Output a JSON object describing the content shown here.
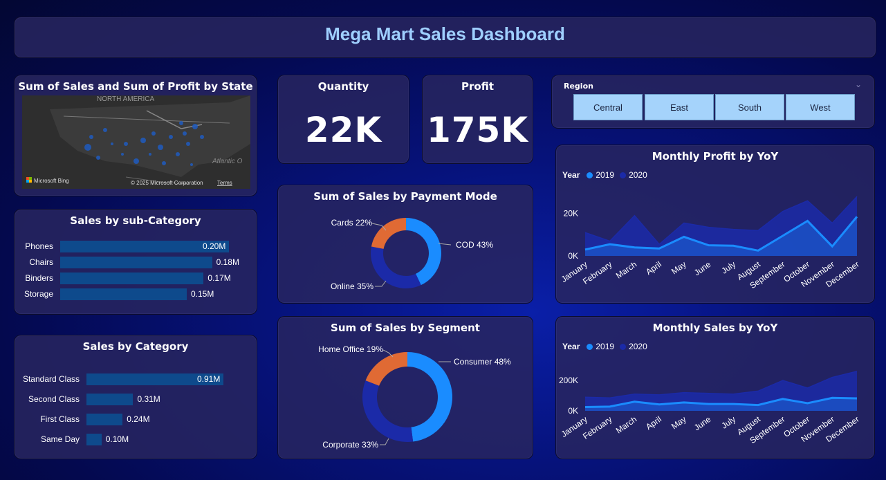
{
  "header": {
    "title": "Mega Mart Sales Dashboard"
  },
  "map_card": {
    "title": "Sum of Sales and Sum of Profit by State",
    "region_label": "NORTH AMERICA",
    "ocean_label": "Atlantic O",
    "bing": "Microsoft Bing",
    "copyright": "© 2025 Microsoft Corporation",
    "terms": "Terms"
  },
  "kpis": {
    "quantity": {
      "title": "Quantity",
      "value": "22K"
    },
    "profit": {
      "title": "Profit",
      "value": "175K"
    }
  },
  "region_slicer": {
    "title": "Region",
    "options": [
      "Central",
      "East",
      "South",
      "West"
    ]
  },
  "subcategory": {
    "title": "Sales by sub-Category",
    "rows": [
      {
        "label": "Phones",
        "value": 0.2,
        "value_label": "0.20M"
      },
      {
        "label": "Chairs",
        "value": 0.18,
        "value_label": "0.18M"
      },
      {
        "label": "Binders",
        "value": 0.17,
        "value_label": "0.17M"
      },
      {
        "label": "Storage",
        "value": 0.15,
        "value_label": "0.15M"
      }
    ]
  },
  "category": {
    "title": "Sales by Category",
    "rows": [
      {
        "label": "Standard Class",
        "value": 0.91,
        "value_label": "0.91M"
      },
      {
        "label": "Second Class",
        "value": 0.31,
        "value_label": "0.31M"
      },
      {
        "label": "First Class",
        "value": 0.24,
        "value_label": "0.24M"
      },
      {
        "label": "Same Day",
        "value": 0.1,
        "value_label": "0.10M"
      }
    ]
  },
  "colors": {
    "blue": "#1a8cff",
    "navy": "#1b2aa8",
    "orange": "#e06a34",
    "bar": "#0e4a8c",
    "title": "#9fcfff"
  },
  "chart_data": [
    {
      "type": "pie",
      "title": "Sum of Sales by Payment Mode",
      "labels": [
        "COD",
        "Online",
        "Cards"
      ],
      "values": [
        43,
        35,
        22
      ],
      "data_labels": [
        "COD 43%",
        "Online 35%",
        "Cards 22%"
      ]
    },
    {
      "type": "pie",
      "title": "Sum of Sales by Segment",
      "labels": [
        "Consumer",
        "Corporate",
        "Home Office"
      ],
      "values": [
        48,
        33,
        19
      ],
      "data_labels": [
        "Consumer 48%",
        "Corporate 33%",
        "Home Office 19%"
      ]
    },
    {
      "type": "area",
      "title": "Monthly Profit by YoY",
      "legend_title": "Year",
      "x": [
        "January",
        "February",
        "March",
        "April",
        "May",
        "June",
        "July",
        "August",
        "September",
        "October",
        "November",
        "December"
      ],
      "y_ticks": [
        "0K",
        "20K"
      ],
      "ylim": [
        0,
        30000
      ],
      "series": [
        {
          "name": "2019",
          "values": [
            3000,
            5500,
            4000,
            3500,
            9000,
            5000,
            4800,
            2500,
            9500,
            16500,
            4500,
            18500
          ]
        },
        {
          "name": "2020",
          "values": [
            11000,
            7000,
            19000,
            5500,
            15500,
            13500,
            12500,
            12000,
            21000,
            26000,
            15500,
            28000
          ]
        }
      ]
    },
    {
      "type": "area",
      "title": "Monthly Sales by YoY",
      "legend_title": "Year",
      "x": [
        "January",
        "February",
        "March",
        "April",
        "May",
        "June",
        "July",
        "August",
        "September",
        "October",
        "November",
        "December"
      ],
      "y_ticks": [
        "0K",
        "200K"
      ],
      "ylim": [
        0,
        300000
      ],
      "series": [
        {
          "name": "2019",
          "values": [
            25000,
            28000,
            60000,
            42000,
            55000,
            45000,
            45000,
            38000,
            78000,
            50000,
            85000,
            82000
          ]
        },
        {
          "name": "2020",
          "values": [
            90000,
            85000,
            110000,
            105000,
            120000,
            115000,
            110000,
            130000,
            200000,
            150000,
            220000,
            260000
          ]
        }
      ]
    }
  ]
}
